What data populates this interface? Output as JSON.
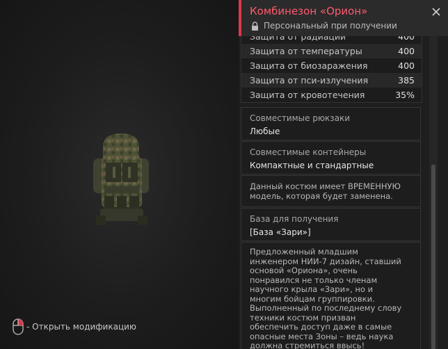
{
  "item": {
    "title": "Комбинезон «Орион»",
    "binding": "Персональный при получении"
  },
  "stats": [
    {
      "label": "Защита от радиации",
      "value": "400"
    },
    {
      "label": "Защита от температуры",
      "value": "400"
    },
    {
      "label": "Защита от биозаражения",
      "value": "400"
    },
    {
      "label": "Защита от пси-излучения",
      "value": "385"
    },
    {
      "label": "Защита от кровотечения",
      "value": "35%"
    }
  ],
  "backpacks": {
    "label": "Совместимые рюкзаки",
    "value": "Любые"
  },
  "containers": {
    "label": "Совместимые контейнеры",
    "value": "Компактные и стандартные"
  },
  "notice": "Данный костюм имеет ВРЕМЕННУЮ модель, которая будет заменена.",
  "base": {
    "label": "База для получения",
    "value": "[База «Зари»]"
  },
  "lore": "Предложенный младшим инженером НИИ-7 дизайн, ставший основой «Ориона», очень понравился не только членам научного крыла «Зари», но и многим бойцам группировки. Выполненный по последнему слову техники костюм призван обеспечить доступ даже в самые опасные места Зоны – ведь наука должна стремиться ввысь!",
  "hint": "- Открыть модификацию",
  "colors": {
    "accent": "#d9384a",
    "title": "#ff5a6e"
  },
  "icons": {
    "close": "close-icon",
    "lock": "lock-icon",
    "mouse": "mouse-icon"
  }
}
